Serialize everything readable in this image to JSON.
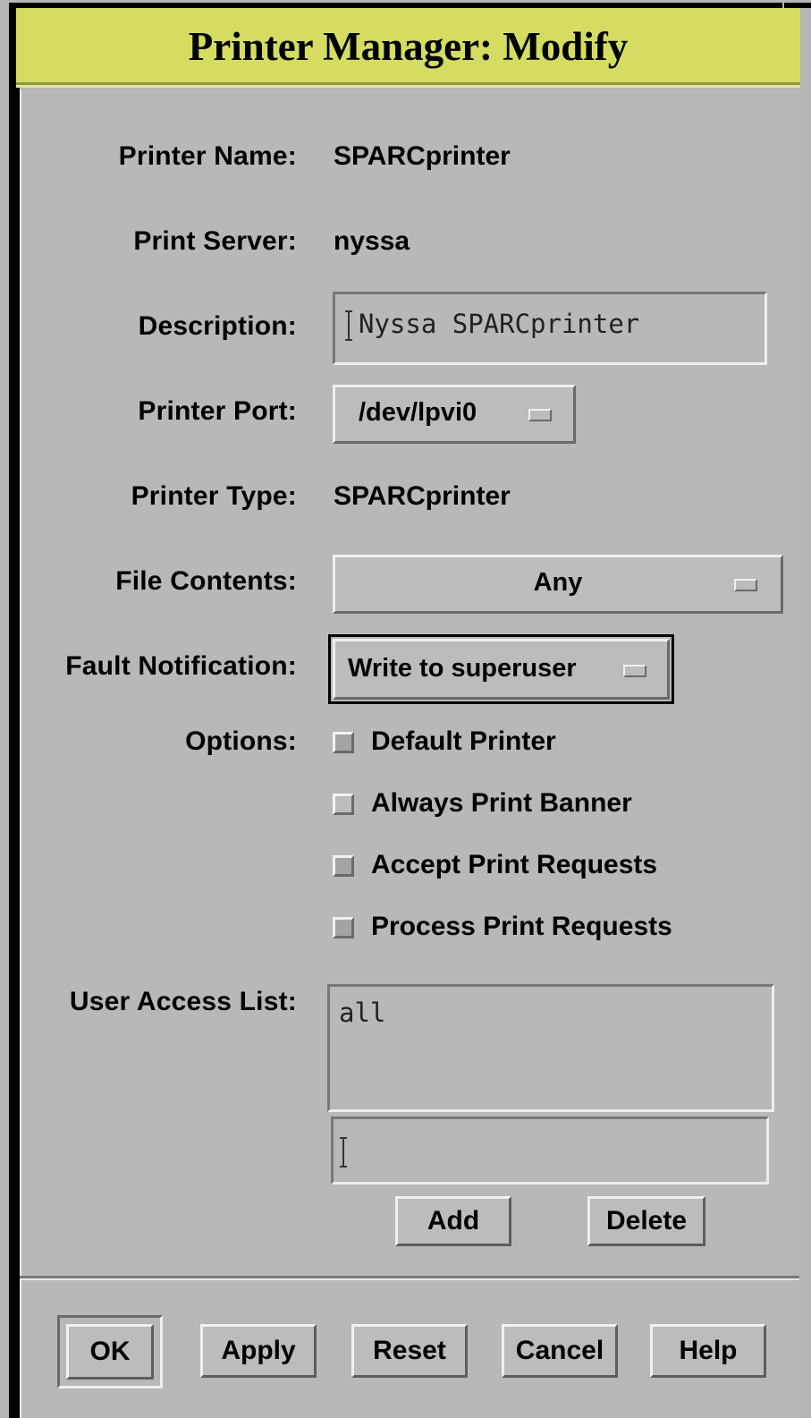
{
  "window": {
    "title": "Printer Manager: Modify"
  },
  "fields": {
    "printer_name": {
      "label": "Printer Name:",
      "value": "SPARCprinter"
    },
    "print_server": {
      "label": "Print Server:",
      "value": "nyssa"
    },
    "description": {
      "label": "Description:",
      "value": "Nyssa SPARCprinter"
    },
    "printer_port": {
      "label": "Printer Port:",
      "value": "/dev/lpvi0"
    },
    "printer_type": {
      "label": "Printer Type:",
      "value": "SPARCprinter"
    },
    "file_contents": {
      "label": "File Contents:",
      "value": "Any"
    },
    "fault_notification": {
      "label": "Fault Notification:",
      "value": "Write to superuser"
    }
  },
  "options": {
    "label": "Options:",
    "items": [
      {
        "label": "Default Printer",
        "checked": true
      },
      {
        "label": "Always Print Banner",
        "checked": false
      },
      {
        "label": "Accept Print Requests",
        "checked": true
      },
      {
        "label": "Process Print Requests",
        "checked": true
      }
    ]
  },
  "user_access": {
    "label": "User Access List:",
    "entries": [
      "all"
    ],
    "input_value": "",
    "add_label": "Add",
    "delete_label": "Delete"
  },
  "footer": {
    "ok": "OK",
    "apply": "Apply",
    "reset": "Reset",
    "cancel": "Cancel",
    "help": "Help"
  },
  "colors": {
    "titlebar": "#d4dd62",
    "panel": "#b8b8b8"
  }
}
